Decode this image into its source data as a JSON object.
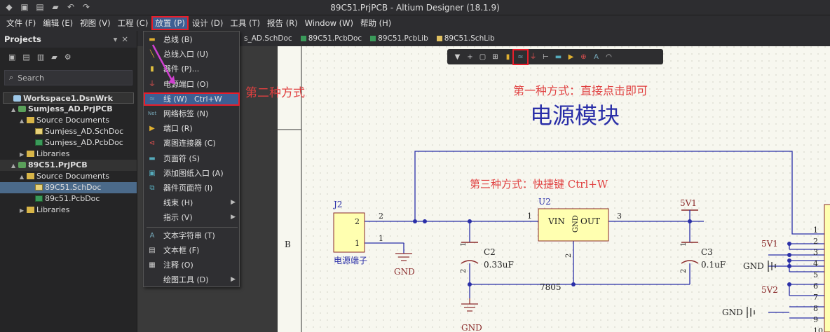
{
  "title": "89C51.PrjPCB - Altium Designer (18.1.9)",
  "menu": [
    "文件 (F)",
    "编辑 (E)",
    "视图 (V)",
    "工程 (C)",
    "放置 (P)",
    "设计 (D)",
    "工具 (T)",
    "报告 (R)",
    "Window (W)",
    "帮助 (H)"
  ],
  "panel": {
    "title": "Projects",
    "search_placeholder": "Search",
    "tree": [
      {
        "label": "Workspace1.DsnWrk",
        "level": 0,
        "type": "ws",
        "bold": true
      },
      {
        "label": "Sumjess_AD.PrjPCB",
        "level": 1,
        "type": "prj",
        "bold": true,
        "tw": "▲"
      },
      {
        "label": "Source Documents",
        "level": 2,
        "type": "fold",
        "tw": "▲"
      },
      {
        "label": "Sumjess_AD.SchDoc",
        "level": 3,
        "type": "sch"
      },
      {
        "label": "Sumjess_AD.PcbDoc",
        "level": 3,
        "type": "pcb"
      },
      {
        "label": "Libraries",
        "level": 2,
        "type": "fold",
        "tw": "▶"
      },
      {
        "label": "89C51.PrjPCB",
        "level": 1,
        "type": "prj",
        "bold": true,
        "tw": "▲",
        "sel2": true
      },
      {
        "label": "Source Documents",
        "level": 2,
        "type": "fold",
        "tw": "▲"
      },
      {
        "label": "89C51.SchDoc",
        "level": 3,
        "type": "sch",
        "sel": true
      },
      {
        "label": "89c51.PcbDoc",
        "level": 3,
        "type": "pcb"
      },
      {
        "label": "Libraries",
        "level": 2,
        "type": "fold",
        "tw": "▶"
      }
    ]
  },
  "tabs": [
    "s_AD.SchDoc",
    "89C51.PcbDoc",
    "89C51.PcbLib",
    "89C51.SchLib"
  ],
  "dropdown": [
    {
      "label": "总线 (B)",
      "icon": "bus"
    },
    {
      "label": "总线入口 (U)",
      "icon": "busentry"
    },
    {
      "label": "器件 (P)...",
      "icon": "part"
    },
    {
      "label": "电源端口 (O)",
      "icon": "power"
    },
    {
      "label": "线 (W)",
      "shortcut": "Ctrl+W",
      "icon": "wire",
      "hi": true
    },
    {
      "label": "网络标签 (N)",
      "icon": "net"
    },
    {
      "label": "端口 (R)",
      "icon": "port"
    },
    {
      "label": "离图连接器 (C)",
      "icon": "offsheet"
    },
    {
      "label": "页面符 (S)",
      "icon": "sheet"
    },
    {
      "label": "添加图纸入口 (A)",
      "icon": "entry"
    },
    {
      "label": "器件页面符 (I)",
      "icon": "devsheet"
    },
    {
      "label": "线束 (H)",
      "sub": true
    },
    {
      "label": "指示 (V)",
      "sub": true,
      "sep": true
    },
    {
      "label": "文本字符串 (T)",
      "icon": "text"
    },
    {
      "label": "文本框 (F)",
      "icon": "textbox"
    },
    {
      "label": "注释 (O)",
      "icon": "note"
    },
    {
      "label": "绘图工具 (D)",
      "sub": true
    }
  ],
  "annotations": {
    "m1": "第一种方式：直接点击即可",
    "m2": "第二种方式",
    "m3": "第三种方式：快捷键 Ctrl+W",
    "heading": "电源模块"
  },
  "schematic": {
    "zone": "B",
    "j2": "J2",
    "j2_name": "电源端子",
    "u2": "U2",
    "u2_vin": "VIN",
    "u2_out": "OUT",
    "u2_gnd": "GND",
    "reg": "7805",
    "c2": "C2",
    "c2_val": "0.33uF",
    "c3": "C3",
    "c3_val": "0.1uF",
    "gnd": "GND",
    "v5v1": "5V1",
    "v5v2": "5V2",
    "pins": [
      "1",
      "2",
      "3",
      "4",
      "5",
      "6",
      "7",
      "8",
      "9",
      "10"
    ],
    "p2": "2",
    "p1": "1",
    "p3": "3",
    "c1": "1",
    "c22": "2"
  },
  "colors": {
    "accent": "#3d5f93",
    "highlight": "#e81e2b",
    "wire": "#2a2fa8",
    "comp_fill": "#ffffb0",
    "comp_edge": "#8a2a2a"
  }
}
